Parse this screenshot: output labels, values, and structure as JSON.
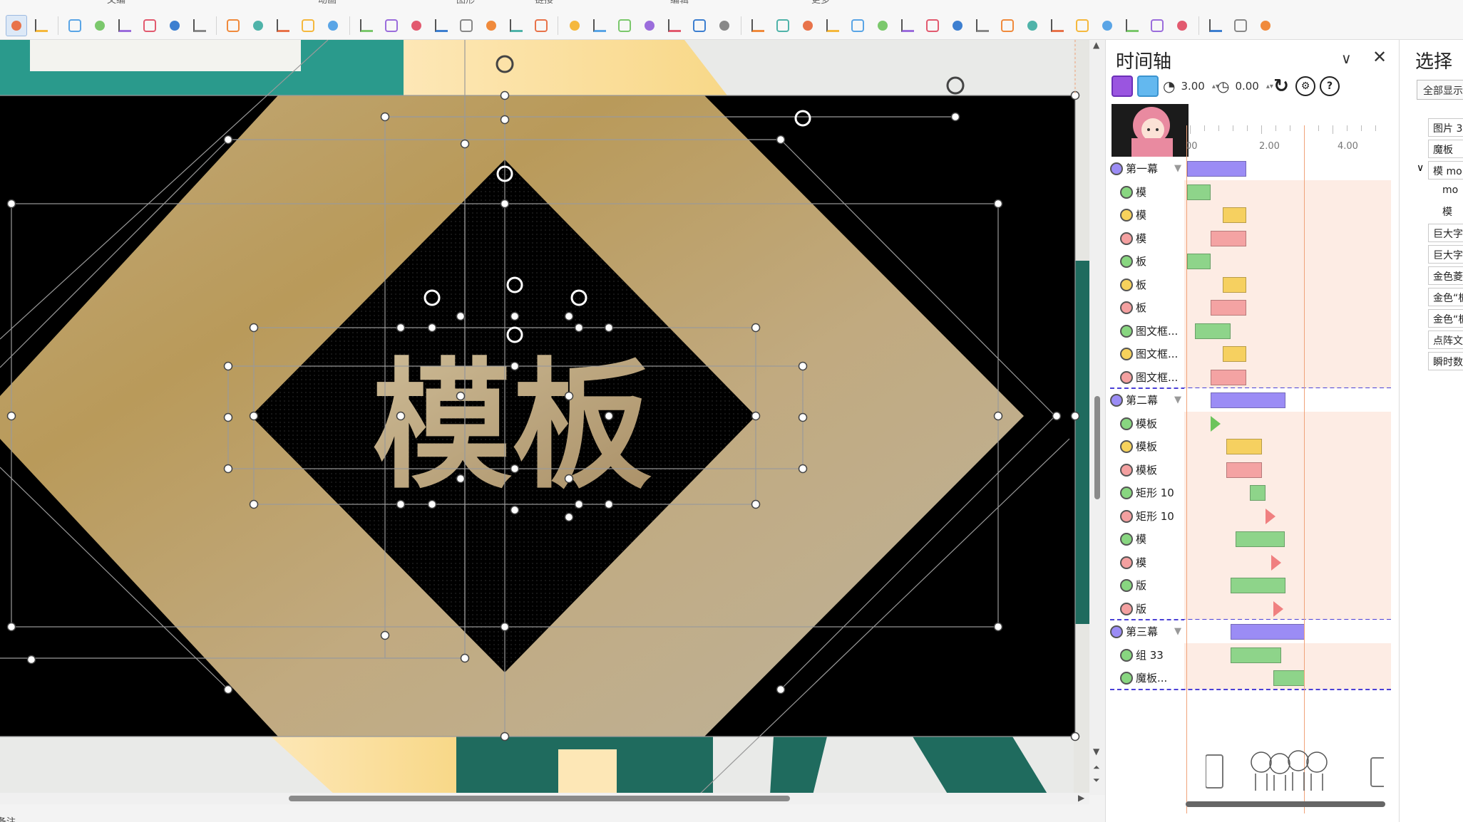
{
  "toolbar": {
    "cut_labels": [
      "文编",
      "动画",
      "图形",
      "链接",
      "编辑",
      "更多"
    ],
    "groups": [
      {
        "icons": [
          "select-cursor-icon",
          "eraser-icon"
        ]
      },
      {
        "icons": [
          "fill-bucket-icon",
          "eyedropper-icon",
          "pen-outline-icon",
          "font-color-icon",
          "text-eyedropper-icon",
          "text-style-icon"
        ]
      },
      {
        "icons": [
          "text-box-icon",
          "shape-insert-icon",
          "shape-copy-icon",
          "merge-shapes-icon",
          "edit-points-icon"
        ]
      },
      {
        "icons": [
          "brush-icon",
          "star-icon",
          "layer-icon",
          "pattern-icon",
          "blue-dot-icon",
          "moon-icon",
          "gradient-icon",
          "palette-icon"
        ]
      },
      {
        "icons": [
          "copy-style-icon",
          "crop-image-icon",
          "image-placeholder-icon",
          "align-green-icon",
          "green-frame-icon",
          "bars-icon",
          "frame-icon"
        ]
      },
      {
        "icons": [
          "effects-star-icon",
          "eye-icon",
          "picture-icon",
          "cut-icon",
          "align-top-icon",
          "fit-icon",
          "distribute-icon",
          "square-icon",
          "align-h-icon",
          "align-v-icon",
          "distribute-v-icon",
          "align-left-icon",
          "center-icon",
          "align-right-icon",
          "equal-width-icon",
          "chart-icon",
          "stack-icon",
          "rotate-icon"
        ]
      },
      {
        "icons": [
          "plugin-icon",
          "settings-icon",
          "overflow-icon"
        ]
      }
    ]
  },
  "canvas": {
    "slide_text": "模板",
    "colors": {
      "teal": "#2a9a8c",
      "dark_teal": "#1f6b5e",
      "cream": "#fde7b6",
      "gold": "#c7a66a",
      "black": "#000000"
    }
  },
  "timeline": {
    "title": "时间轴",
    "duration": "3.00",
    "delay": "0.00",
    "ruler": [
      "00",
      "2.00",
      "4.00"
    ],
    "rows": [
      {
        "label": "第一幕",
        "type": "scene",
        "dot": "#9b8cf5",
        "bar": {
          "start": 0,
          "end": 0.75,
          "color": "#9b8cf5"
        }
      },
      {
        "label": "模",
        "type": "anim",
        "dot": "#88d680",
        "bar": {
          "start": 0,
          "end": 0.3,
          "color": "#8ed48a"
        }
      },
      {
        "label": "模",
        "type": "anim",
        "dot": "#f7d25c",
        "bar": {
          "start": 0.45,
          "end": 0.75,
          "color": "#f6d060"
        }
      },
      {
        "label": "模",
        "type": "anim",
        "dot": "#f4a0a0",
        "bar": {
          "start": 0.3,
          "end": 0.75,
          "color": "#f4a3a3"
        }
      },
      {
        "label": "板",
        "type": "anim",
        "dot": "#88d680",
        "bar": {
          "start": 0,
          "end": 0.3,
          "color": "#8ed48a"
        }
      },
      {
        "label": "板",
        "type": "anim",
        "dot": "#f7d25c",
        "bar": {
          "start": 0.45,
          "end": 0.75,
          "color": "#f6d060"
        }
      },
      {
        "label": "板",
        "type": "anim",
        "dot": "#f4a0a0",
        "bar": {
          "start": 0.3,
          "end": 0.75,
          "color": "#f4a3a3"
        }
      },
      {
        "label": "图文框...",
        "type": "anim",
        "dot": "#88d680",
        "bar": {
          "start": 0.1,
          "end": 0.55,
          "color": "#8ed48a"
        }
      },
      {
        "label": "图文框...",
        "type": "anim",
        "dot": "#f7d25c",
        "bar": {
          "start": 0.45,
          "end": 0.75,
          "color": "#f6d060"
        }
      },
      {
        "label": "图文框...",
        "type": "anim",
        "dot": "#f4a0a0",
        "bar": {
          "start": 0.3,
          "end": 0.75,
          "color": "#f4a3a3"
        }
      },
      {
        "label": "第二幕",
        "type": "scene",
        "dot": "#9b8cf5",
        "bar": {
          "start": 0.3,
          "end": 1.25,
          "color": "#9b8cf5"
        }
      },
      {
        "label": "模板",
        "type": "anim",
        "dot": "#88d680",
        "mark": {
          "at": 0.3,
          "color": "#6cc45c"
        }
      },
      {
        "label": "模板",
        "type": "anim",
        "dot": "#f7d25c",
        "bar": {
          "start": 0.5,
          "end": 0.95,
          "color": "#f6d060"
        }
      },
      {
        "label": "模板",
        "type": "anim",
        "dot": "#f4a0a0",
        "bar": {
          "start": 0.5,
          "end": 0.95,
          "color": "#f4a3a3"
        }
      },
      {
        "label": "矩形 10",
        "type": "anim",
        "dot": "#88d680",
        "bar": {
          "start": 0.8,
          "end": 1.0,
          "color": "#8ed48a"
        }
      },
      {
        "label": "矩形 10",
        "type": "anim",
        "dot": "#f4a0a0",
        "mark": {
          "at": 1.0,
          "color": "#f08080"
        }
      },
      {
        "label": "模",
        "type": "anim",
        "dot": "#88d680",
        "bar": {
          "start": 0.62,
          "end": 1.25,
          "color": "#8ed48a"
        }
      },
      {
        "label": "模",
        "type": "anim",
        "dot": "#f4a0a0",
        "mark": {
          "at": 1.07,
          "color": "#f08080"
        }
      },
      {
        "label": "版",
        "type": "anim",
        "dot": "#88d680",
        "bar": {
          "start": 0.55,
          "end": 1.25,
          "color": "#8ed48a"
        }
      },
      {
        "label": "版",
        "type": "anim",
        "dot": "#f4a0a0",
        "mark": {
          "at": 1.1,
          "color": "#f08080"
        }
      },
      {
        "label": "第三幕",
        "type": "scene",
        "dot": "#9b8cf5",
        "bar": {
          "start": 0.55,
          "end": 1.5,
          "color": "#9b8cf5"
        }
      },
      {
        "label": "组 33",
        "type": "anim",
        "dot": "#88d680",
        "bar": {
          "start": 0.55,
          "end": 1.2,
          "color": "#8ed48a"
        }
      },
      {
        "label": "魔板...",
        "type": "anim",
        "dot": "#88d680",
        "bar": {
          "start": 1.1,
          "end": 1.5,
          "color": "#8ed48a"
        }
      }
    ]
  },
  "selection": {
    "title": "选择",
    "show_all": "全部显示",
    "items": [
      "图片 3",
      "魔板",
      "模 mo",
      "mo",
      "模",
      "巨大字",
      "巨大字",
      "金色菱",
      "金色“板",
      "金色“板",
      "点阵文",
      "瞬时数"
    ]
  },
  "statusbar": {
    "text": "备注"
  }
}
